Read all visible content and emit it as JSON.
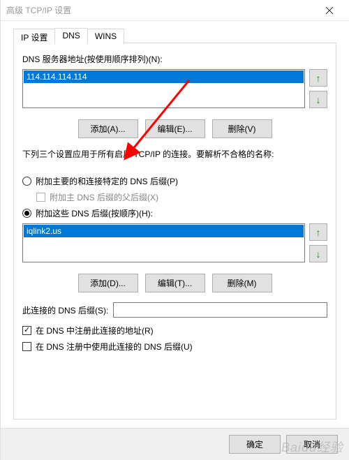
{
  "window": {
    "title": "高级 TCP/IP 设置"
  },
  "tabs": {
    "ip": "IP 设置",
    "dns": "DNS",
    "wins": "WINS"
  },
  "dns_list": {
    "label": "DNS 服务器地址(按使用顺序排列)(N):",
    "items": [
      "114.114.114.114"
    ],
    "add": "添加(A)...",
    "edit": "编辑(E)...",
    "remove": "删除(V)"
  },
  "note": "下列三个设置应用于所有启用 TCP/IP 的连接。要解析不合格的名称:",
  "radio1": {
    "label": "附加主要的和连接特定的 DNS 后缀(P)",
    "sublabel": "附加主 DNS 后缀的父后缀(X)"
  },
  "radio2": {
    "label": "附加这些 DNS 后缀(按顺序)(H):"
  },
  "suffix_list": {
    "items": [
      "iqlink2.us"
    ],
    "add": "添加(D)...",
    "edit": "编辑(T)...",
    "remove": "删除(M)"
  },
  "conn_suffix": {
    "label": "此连接的 DNS 后缀(S):",
    "value": ""
  },
  "check1": "在 DNS 中注册此连接的地址(R)",
  "check2": "在 DNS 注册中使用此连接的 DNS 后缀(U)",
  "footer": {
    "ok": "确定",
    "cancel": "取消"
  },
  "watermark": "Baidu经验"
}
